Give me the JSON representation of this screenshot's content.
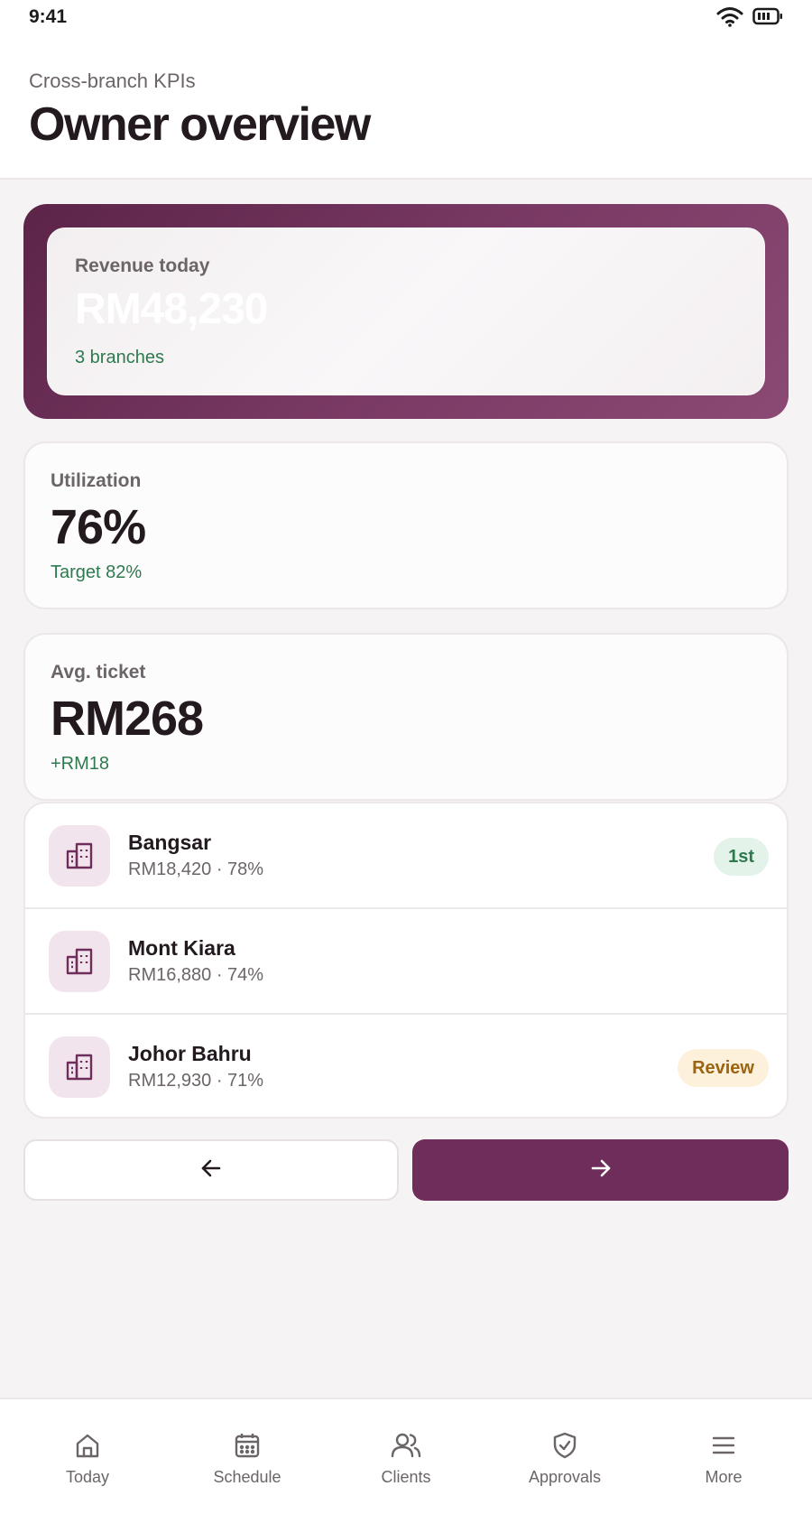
{
  "status_bar": {
    "time": "9:41"
  },
  "header": {
    "subtitle": "Cross-branch KPIs",
    "title": "Owner overview"
  },
  "hero": {
    "label": "Revenue today",
    "value": "RM48,230",
    "note": "3 branches"
  },
  "kpis": [
    {
      "label": "Utilization",
      "value": "76%",
      "note": "Target 82%"
    },
    {
      "label": "Avg. ticket",
      "value": "RM268",
      "note": "+RM18"
    }
  ],
  "branches": [
    {
      "name": "Bangsar",
      "meta": "RM18,420 · 78%",
      "badge": "1st",
      "icon": "building-icon"
    },
    {
      "name": "Mont Kiara",
      "meta": "RM16,880 · 74%",
      "badge": "",
      "icon": "building-icon"
    },
    {
      "name": "Johor Bahru",
      "meta": "RM12,930 · 71%",
      "badge": "Review",
      "icon": "building-icon"
    }
  ],
  "pager": {
    "prev_icon": "arrow-left-icon",
    "next_icon": "arrow-right-icon"
  },
  "tabs": [
    {
      "label": "Today",
      "icon": "home-icon"
    },
    {
      "label": "Schedule",
      "icon": "calendar-icon"
    },
    {
      "label": "Clients",
      "icon": "users-icon"
    },
    {
      "label": "Approvals",
      "icon": "shield-check-icon"
    },
    {
      "label": "More",
      "icon": "menu-icon"
    }
  ],
  "colors": {
    "brand": "#6e2d5a",
    "positive": "#2e7a4f",
    "warning": "#9a6410",
    "background": "#f5f3f4"
  }
}
